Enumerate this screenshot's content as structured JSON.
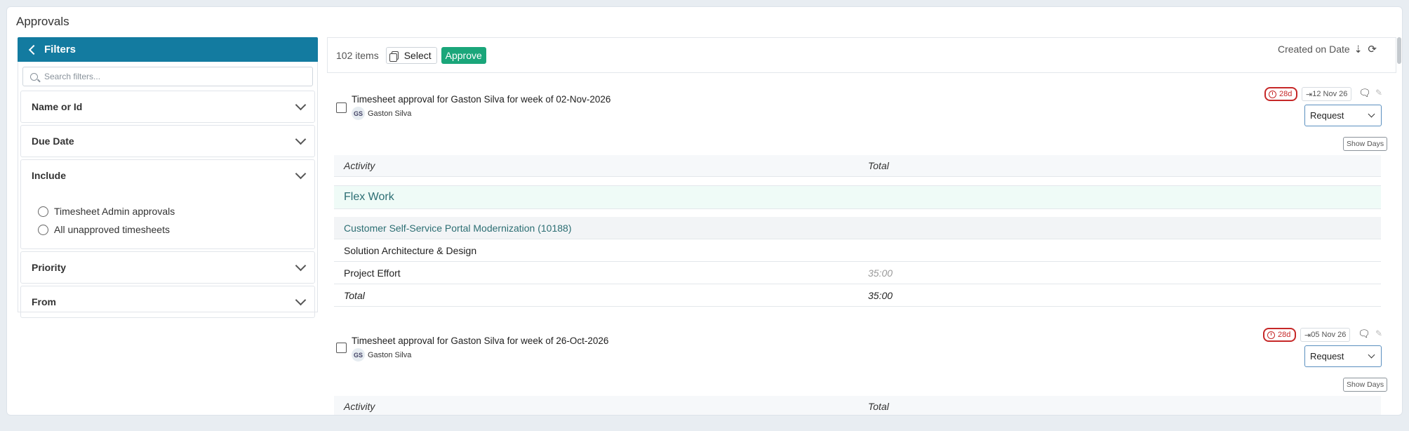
{
  "page": {
    "title": "Approvals"
  },
  "filters": {
    "header_label": "Filters",
    "search_placeholder": "Search filters...",
    "sections": {
      "name_or_id": "Name or Id",
      "due_date": "Due Date",
      "include": "Include",
      "priority": "Priority",
      "from": "From"
    },
    "include_options": [
      "Timesheet Admin approvals",
      "All unapproved timesheets"
    ]
  },
  "toolbar": {
    "count": "102 items",
    "select_label": "Select",
    "approve_label": "Approve",
    "sort_label": "Created on Date"
  },
  "approvals": [
    {
      "title": "Timesheet approval for Gaston Silva for week of 02-Nov-2026",
      "user_initials": "GS",
      "user_name": "Gaston Silva",
      "age": "28d",
      "date": "12 Nov 26",
      "action": "Request",
      "show_days": "Show Days",
      "table": {
        "headers": [
          "Activity",
          "Total"
        ],
        "group": "Flex Work",
        "project": "Customer Self-Service Portal Modernization (10188)",
        "task": "Solution Architecture & Design",
        "line_label": "Project Effort",
        "line_value": "35:00",
        "total_label": "Total",
        "total_value": "35:00"
      }
    },
    {
      "title": "Timesheet approval for Gaston Silva for week of 26-Oct-2026",
      "user_initials": "GS",
      "user_name": "Gaston Silva",
      "age": "28d",
      "date": "05 Nov 26",
      "action": "Request",
      "show_days": "Show Days",
      "table": {
        "headers": [
          "Activity",
          "Total"
        ]
      }
    }
  ],
  "colors": {
    "header_blue": "#137ba0",
    "approve_green": "#1aa67a",
    "overdue_red": "#c62828",
    "group_text": "#2c6e73"
  }
}
